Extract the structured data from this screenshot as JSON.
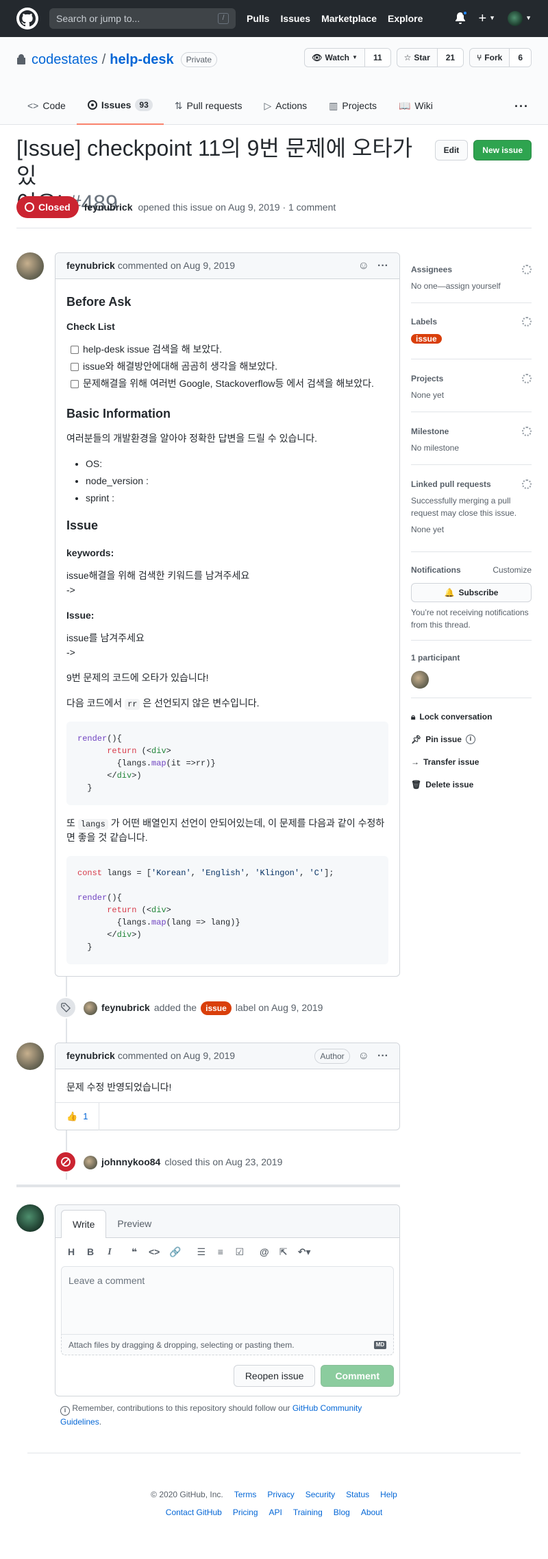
{
  "header": {
    "search_placeholder": "Search or jump to...",
    "search_hint": "/",
    "nav": [
      "Pulls",
      "Issues",
      "Marketplace",
      "Explore"
    ]
  },
  "repo": {
    "owner": "codestates",
    "sep": "/",
    "name": "help-desk",
    "visibility": "Private",
    "watch_label": "Watch",
    "watch_count": "11",
    "star_label": "Star",
    "star_count": "21",
    "fork_label": "Fork",
    "fork_count": "6",
    "tabs": [
      {
        "label": "Code"
      },
      {
        "label": "Issues",
        "count": "93"
      },
      {
        "label": "Pull requests"
      },
      {
        "label": "Actions"
      },
      {
        "label": "Projects"
      },
      {
        "label": "Wiki"
      }
    ],
    "more": "···"
  },
  "issue": {
    "title_line1": "[Issue] checkpoint 11의 9번 문제에 오타가 있",
    "title_line2": "어요!",
    "number": "#489",
    "edit_label": "Edit",
    "new_issue_label": "New issue",
    "state": "Closed",
    "author": "feynubrick",
    "meta": "opened this issue on Aug 9, 2019 · 1 comment"
  },
  "comment1": {
    "author": "feynubrick",
    "meta": "commented on Aug 9, 2019",
    "h_before": "Before Ask",
    "h_checklist": "Check List",
    "checks": [
      "help-desk issue 검색을 해 보았다.",
      "issue와 해결방안에대해 곰곰히 생각을 해보았다.",
      "문제해결을 위해 여러번 Google, Stackoverflow등 에서 검색을 해보았다."
    ],
    "h_basic": "Basic Information",
    "basic_desc": "여러분들의 개발환경을 알아야 정확한 답변을 드릴 수 있습니다.",
    "basic_items": [
      "OS:",
      "node_version :",
      "sprint :"
    ],
    "h_issue": "Issue",
    "h_keywords": "keywords:",
    "keywords_text": "issue해결을 위해 검색한 키워드를 남겨주세요",
    "arrow": "->",
    "h_issue2": "Issue:",
    "issue_text": "issue를 남겨주세요",
    "p_typo": "9번 문제의 코드에 오타가 있습니다!",
    "p_code_pre": "다음 코드에서",
    "p_code_var": "rr",
    "p_code_post": "은 선언되지 않은 변수입니다.",
    "p_langs_pre": "또",
    "p_langs_var": "langs",
    "p_langs_post": "가 어떤 배열인지 선언이 안되어있는데, 이 문제를 다음과 같이 수정하면 좋을 것 같습니다."
  },
  "event_label": {
    "author": "feynubrick",
    "before": "added the",
    "label": "issue",
    "after": "label on Aug 9, 2019"
  },
  "comment2": {
    "author": "feynubrick",
    "meta": "commented on Aug 9, 2019",
    "badge": "Author",
    "body": "문제 수정 반영되었습니다!",
    "reaction_emoji": "👍",
    "reaction_count": "1"
  },
  "event_closed": {
    "author": "johnnykoo84",
    "text": "closed this on Aug 23, 2019"
  },
  "composer": {
    "tab_write": "Write",
    "tab_preview": "Preview",
    "placeholder": "Leave a comment",
    "attach": "Attach files by dragging & dropping, selecting or pasting them.",
    "md_icon": "MD",
    "reopen_label": "Reopen issue",
    "comment_label": "Comment",
    "remember_pre": "Remember, contributions to this repository should follow our",
    "remember_link": "GitHub Community Guidelines",
    "remember_post": "."
  },
  "sidebar": {
    "assignees_h": "Assignees",
    "assignees_v": "No one—assign yourself",
    "labels_h": "Labels",
    "labels_v": "issue",
    "projects_h": "Projects",
    "projects_v": "None yet",
    "milestone_h": "Milestone",
    "milestone_v": "No milestone",
    "linked_h": "Linked pull requests",
    "linked_desc": "Successfully merging a pull request may close this issue.",
    "linked_v": "None yet",
    "notif_h": "Notifications",
    "notif_customize": "Customize",
    "subscribe": "Subscribe",
    "notif_desc": "You’re not receiving notifications from this thread.",
    "participants_h": "1 participant",
    "lock": "Lock conversation",
    "pin": "Pin issue",
    "transfer": "Transfer issue",
    "delete": "Delete issue"
  },
  "footer": {
    "copyright": "© 2020 GitHub, Inc.",
    "row1": [
      "Terms",
      "Privacy",
      "Security",
      "Status",
      "Help"
    ],
    "row2": [
      "Contact GitHub",
      "Pricing",
      "API",
      "Training",
      "Blog",
      "About"
    ]
  },
  "colors": {
    "closed": "#cb2431",
    "label_issue": "#d93f0b",
    "green": "#2ea44f",
    "link": "#0366d6"
  }
}
